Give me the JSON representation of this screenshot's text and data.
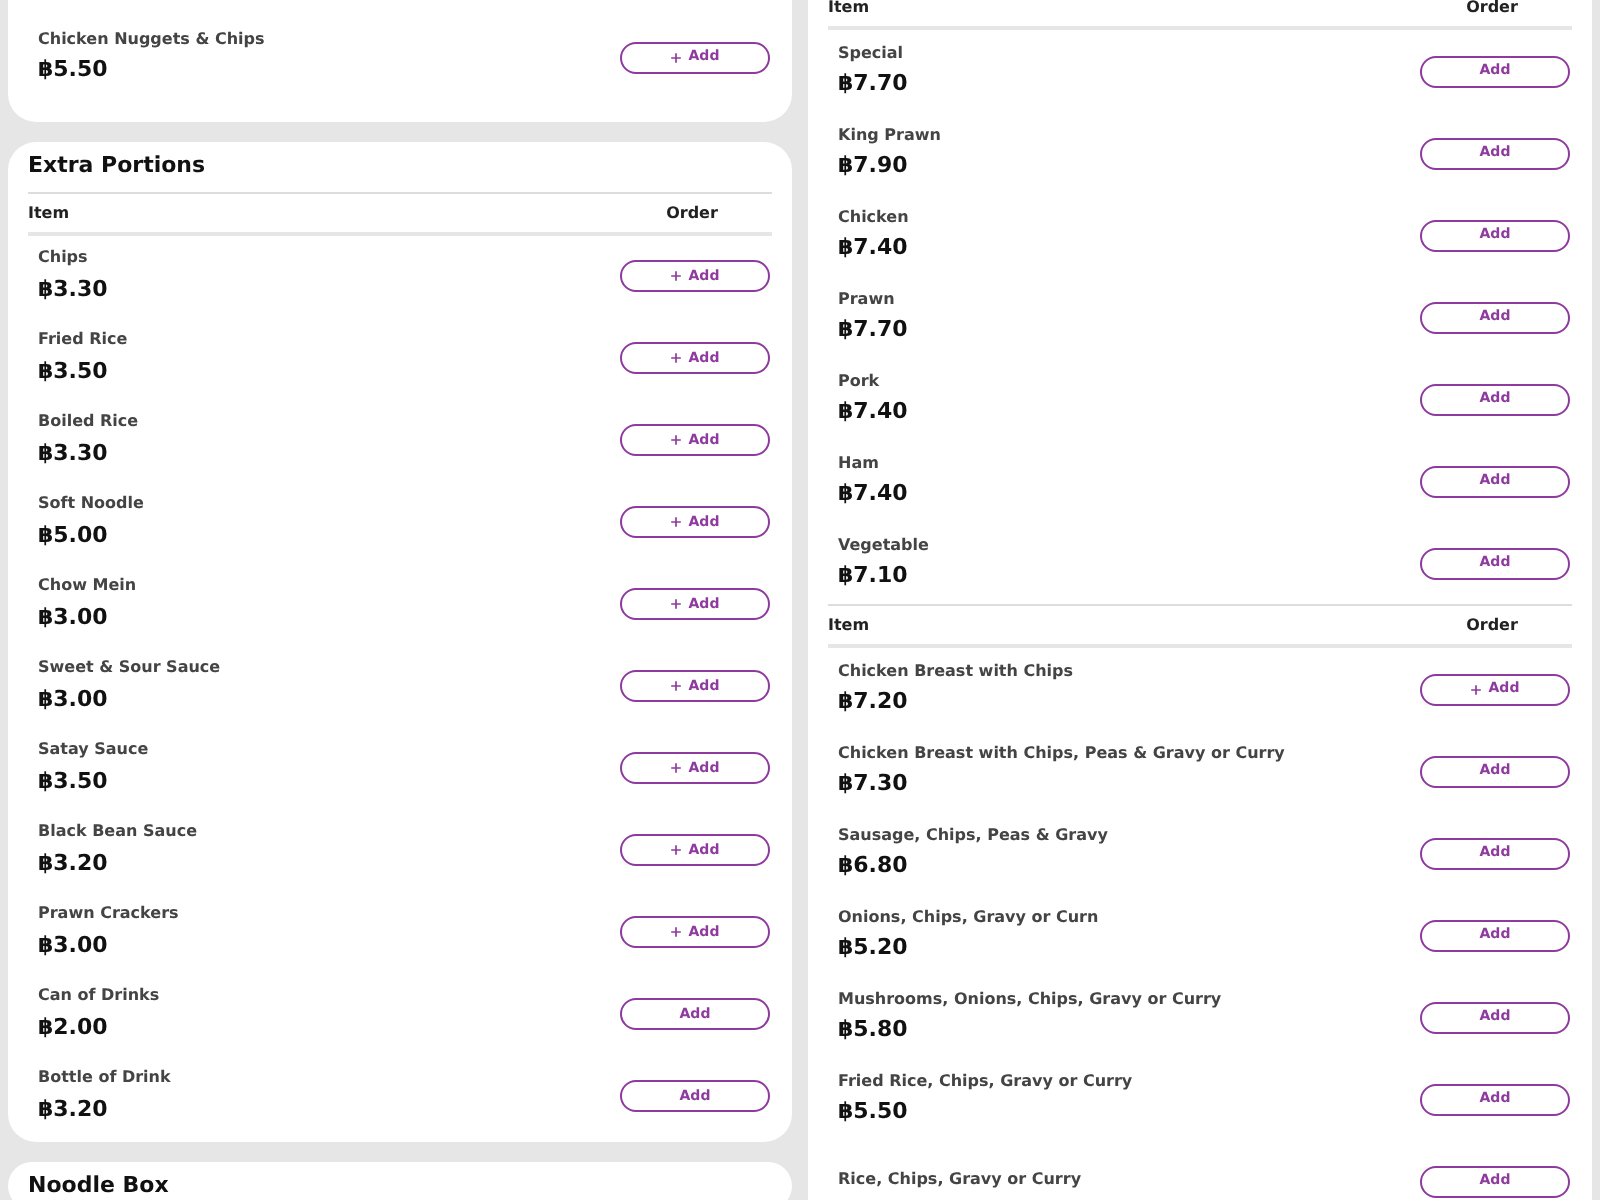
{
  "left_column": {
    "top_card": {
      "items": [
        {
          "name": "Chicken Nuggets & Chips",
          "price": "฿5.50",
          "button": "Add",
          "plus": true
        }
      ]
    },
    "extra_portions": {
      "title": "Extra Portions",
      "columns": [
        "Item",
        "Order"
      ],
      "items": [
        {
          "name": "Chips",
          "price": "฿3.30",
          "button": "Add",
          "plus": true
        },
        {
          "name": "Fried Rice",
          "price": "฿3.50",
          "button": "Add",
          "plus": true
        },
        {
          "name": "Boiled Rice",
          "price": "฿3.30",
          "button": "Add",
          "plus": true
        },
        {
          "name": "Soft Noodle",
          "price": "฿5.00",
          "button": "Add",
          "plus": true
        },
        {
          "name": "Chow Mein",
          "price": "฿3.00",
          "button": "Add",
          "plus": true
        },
        {
          "name": "Sweet & Sour Sauce",
          "price": "฿3.00",
          "button": "Add",
          "plus": true
        },
        {
          "name": "Satay Sauce",
          "price": "฿3.50",
          "button": "Add",
          "plus": true
        },
        {
          "name": "Black Bean Sauce",
          "price": "฿3.20",
          "button": "Add",
          "plus": true
        },
        {
          "name": "Prawn Crackers",
          "price": "฿3.00",
          "button": "Add",
          "plus": true
        },
        {
          "name": "Can of Drinks",
          "price": "฿2.00",
          "button": "Add",
          "plus": false
        },
        {
          "name": "Bottle of Drink",
          "price": "฿3.20",
          "button": "Add",
          "plus": false
        }
      ]
    },
    "next_card": {
      "title": "Noodle Box"
    }
  },
  "right_column": {
    "tables": [
      {
        "columns": [
          "Item",
          "Order"
        ],
        "items": [
          {
            "name": "Special",
            "price": "฿7.70",
            "button": "Add",
            "plus": false
          },
          {
            "name": "King Prawn",
            "price": "฿7.90",
            "button": "Add",
            "plus": false
          },
          {
            "name": "Chicken",
            "price": "฿7.40",
            "button": "Add",
            "plus": false
          },
          {
            "name": "Prawn",
            "price": "฿7.70",
            "button": "Add",
            "plus": false
          },
          {
            "name": "Pork",
            "price": "฿7.40",
            "button": "Add",
            "plus": false
          },
          {
            "name": "Ham",
            "price": "฿7.40",
            "button": "Add",
            "plus": false
          },
          {
            "name": "Vegetable",
            "price": "฿7.10",
            "button": "Add",
            "plus": false
          }
        ]
      },
      {
        "columns": [
          "Item",
          "Order"
        ],
        "items": [
          {
            "name": "Chicken Breast with Chips",
            "price": "฿7.20",
            "button": "Add",
            "plus": true
          },
          {
            "name": "Chicken Breast with Chips, Peas & Gravy or Curry",
            "price": "฿7.30",
            "button": "Add",
            "plus": false
          },
          {
            "name": "Sausage, Chips, Peas & Gravy",
            "price": "฿6.80",
            "button": "Add",
            "plus": false
          },
          {
            "name": "Onions, Chips, Gravy or Curn",
            "price": "฿5.20",
            "button": "Add",
            "plus": false
          },
          {
            "name": "Mushrooms, Onions, Chips, Gravy or Curry",
            "price": "฿5.80",
            "button": "Add",
            "plus": false
          },
          {
            "name": "Fried Rice, Chips, Gravy or Curry",
            "price": "฿5.50",
            "button": "Add",
            "plus": false
          },
          {
            "name": "Rice, Chips, Gravy or Curry",
            "button": "Add",
            "plus": false
          }
        ]
      }
    ]
  }
}
